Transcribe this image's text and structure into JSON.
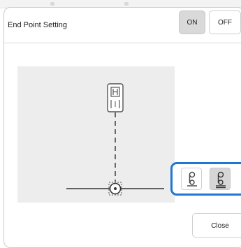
{
  "dialog": {
    "title": "End Point Setting",
    "toggle": {
      "on_label": "ON",
      "off_label": "OFF",
      "selected": "ON"
    },
    "close_label": "Close"
  },
  "options": [
    {
      "icon": "presser-foot-stop-icon",
      "selected": false
    },
    {
      "icon": "presser-foot-stop-underline-icon",
      "selected": true
    }
  ],
  "colors": {
    "accent": "#1e78d2",
    "preview_bg": "#ededed",
    "selected_bg": "#d6d6d6"
  }
}
